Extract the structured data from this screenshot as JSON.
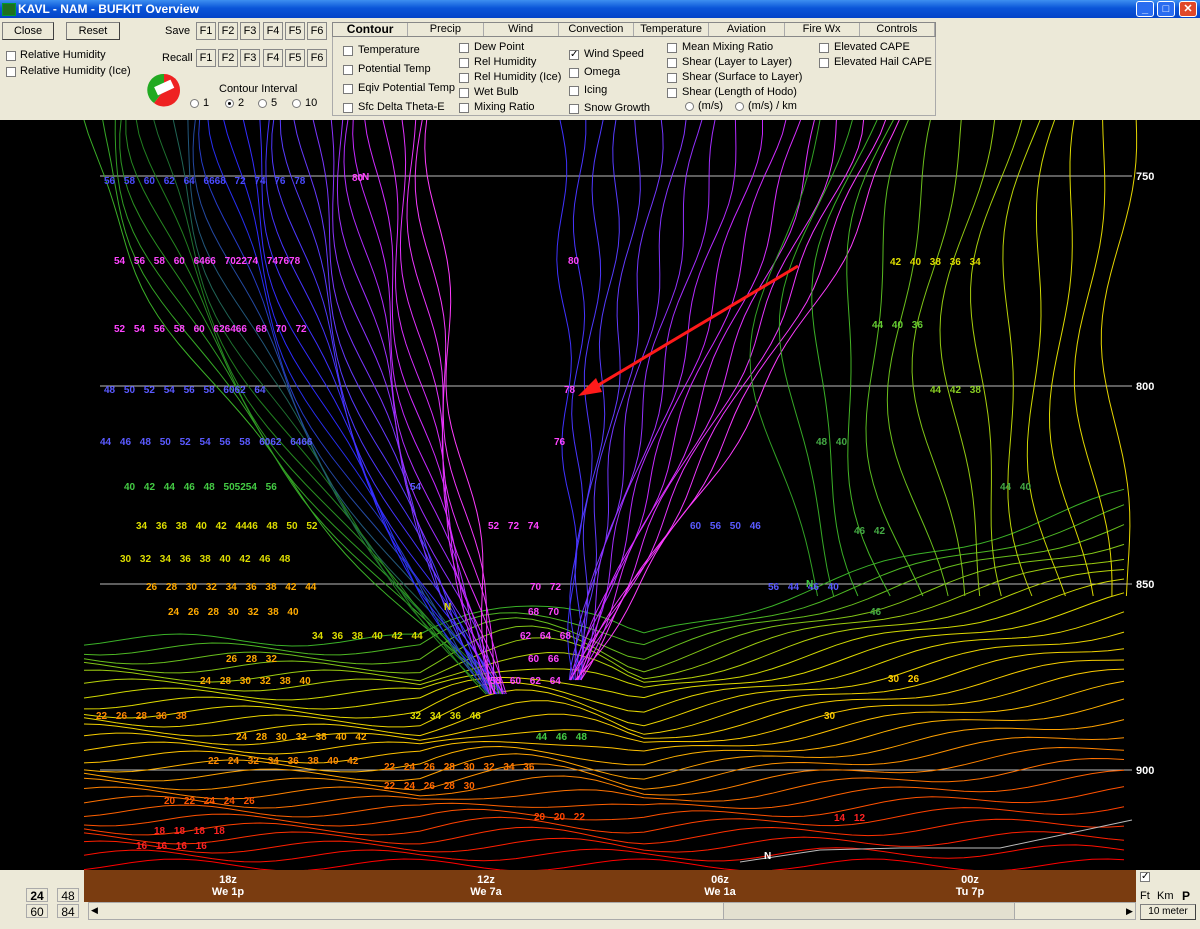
{
  "window": {
    "title": "KAVL - NAM - BUFKIT Overview",
    "minimize": "_",
    "maximize": "□",
    "close": "✕"
  },
  "toolbar": {
    "close_label": "Close",
    "reset_label": "Reset",
    "save_label": "Save",
    "recall_label": "Recall",
    "fkeys": [
      "F1",
      "F2",
      "F3",
      "F4",
      "F5",
      "F6"
    ],
    "rh_label": "Relative Humidity",
    "rh_ice_label": "Relative Humidity (Ice)",
    "contour_interval_label": "Contour Interval",
    "intervals": [
      "1",
      "2",
      "5",
      "10"
    ],
    "interval_selected": "2"
  },
  "tabs": [
    "Contour",
    "Precip",
    "Wind",
    "Convection",
    "Temperature",
    "Aviation",
    "Fire Wx",
    "Controls"
  ],
  "active_tab": "Contour",
  "options": {
    "col1": [
      "Temperature",
      "Potential Temp",
      "Eqiv Potential Temp",
      "Sfc Delta Theta-E"
    ],
    "col2": [
      "Dew Point",
      "Rel Humidity",
      "Rel Humidity (Ice)",
      "Wet Bulb",
      "Mixing Ratio"
    ],
    "col3": [
      "Wind Speed",
      "Omega",
      "Icing",
      "Snow Growth"
    ],
    "col4": [
      "Mean Mixing Ratio",
      "Shear (Layer to Layer)",
      "Shear (Surface to Layer)",
      "Shear (Length of Hodo)"
    ],
    "col4_units": [
      "(m/s)",
      "(m/s) / km"
    ],
    "col5": [
      "Elevated CAPE",
      "Elevated Hail CAPE"
    ],
    "checked": "Wind Speed"
  },
  "plot": {
    "pressure_levels": [
      "750",
      "800",
      "850",
      "900"
    ],
    "labels": [
      {
        "t": "56 58 60 62 64 6668 72 74 76 78",
        "c": "#4a4aff"
      },
      {
        "t": "80",
        "c": "#ff44ff"
      },
      {
        "t": "54 56 58 60 6466 702274 747678",
        "c": "#ff44ff"
      },
      {
        "t": "80",
        "c": "#ff44ff"
      },
      {
        "t": "52 54 56 58 60 626466 68 70 72",
        "c": "#ff44ff"
      },
      {
        "t": "48 50 52 54 56 58 6062 64",
        "c": "#5a5aff"
      },
      {
        "t": "78",
        "c": "#ff44ff"
      },
      {
        "t": "76",
        "c": "#ff44ff"
      },
      {
        "t": "44 46 48 50 52 54 56 58 6062 6466",
        "c": "#5a5aff"
      },
      {
        "t": "40 42 44 46 48 505254 56",
        "c": "#44cc44"
      },
      {
        "t": "54",
        "c": "#5a5aff"
      },
      {
        "t": "34 36 38 40 42 4446 48 50 52",
        "c": "#dddd00"
      },
      {
        "t": "52 72 74",
        "c": "#ff44ff"
      },
      {
        "t": "30 32 34 36 38 40 42 46 48",
        "c": "#dddd00"
      },
      {
        "t": "26 28 30 32 34 36 38 42 44",
        "c": "#ffaa00"
      },
      {
        "t": "70 72",
        "c": "#ff44ff"
      },
      {
        "t": "24 26 28 30 32 38 40",
        "c": "#ffaa00"
      },
      {
        "t": "68 70",
        "c": "#ff44ff"
      },
      {
        "t": "34 36 38 40 42 44",
        "c": "#dddd00"
      },
      {
        "t": "62 64 68",
        "c": "#ff44ff"
      },
      {
        "t": "26 28 32",
        "c": "#ffaa00"
      },
      {
        "t": "60 66",
        "c": "#ff44ff"
      },
      {
        "t": "24 28 30 32 38 40",
        "c": "#ffaa00"
      },
      {
        "t": "58 60 62 64",
        "c": "#ff44ff"
      },
      {
        "t": "22 26 28 36 38",
        "c": "#ff8800"
      },
      {
        "t": "32 34 36 46",
        "c": "#dddd00"
      },
      {
        "t": "24 28 30 32 38 40 42",
        "c": "#ffaa00"
      },
      {
        "t": "44 46 48",
        "c": "#44cc44"
      },
      {
        "t": "22 24 32 34 36 38 40 42",
        "c": "#ff8800"
      },
      {
        "t": "22 24 26 28 30 32 34 36",
        "c": "#ff7700"
      },
      {
        "t": "22 24 26 28 30",
        "c": "#ff6600"
      },
      {
        "t": "20 22 24 24 26",
        "c": "#ff5500"
      },
      {
        "t": "20 20 22",
        "c": "#ff4400"
      },
      {
        "t": "18 18 18 18",
        "c": "#ff2222"
      },
      {
        "t": "16 16 16 16",
        "c": "#ff2222"
      },
      {
        "t": "42 40 38 36 34",
        "c": "#dddd00"
      },
      {
        "t": "44 40 36",
        "c": "#66cc33"
      },
      {
        "t": "44 42 38",
        "c": "#88cc22"
      },
      {
        "t": "48 40",
        "c": "#44aa44"
      },
      {
        "t": "44 40",
        "c": "#44aa44"
      },
      {
        "t": "60 56 50 46",
        "c": "#5a5aff"
      },
      {
        "t": "46 42",
        "c": "#44aa44"
      },
      {
        "t": "56 44 46 40",
        "c": "#5a5aff"
      },
      {
        "t": "46",
        "c": "#44aa44"
      },
      {
        "t": "30 26",
        "c": "#ffcc00"
      },
      {
        "t": "30",
        "c": "#ffcc00"
      },
      {
        "t": "14 12",
        "c": "#ff2222"
      },
      {
        "t": "N",
        "c": "#ff44ff"
      },
      {
        "t": "N",
        "c": "#44cc44"
      },
      {
        "t": "N",
        "c": "#dddd00"
      },
      {
        "t": "N",
        "c": "#ffffff"
      }
    ]
  },
  "timeline": [
    {
      "z": "18z",
      "d": "We 1p"
    },
    {
      "z": "12z",
      "d": "We 7a"
    },
    {
      "z": "06z",
      "d": "We 1a"
    },
    {
      "z": "00z",
      "d": "Tu 7p"
    }
  ],
  "bottom": {
    "hours": [
      "24",
      "48",
      "60",
      "84"
    ],
    "units": [
      "Ft",
      "Km",
      "P"
    ],
    "level_label": "10 meter",
    "check": "✓"
  }
}
